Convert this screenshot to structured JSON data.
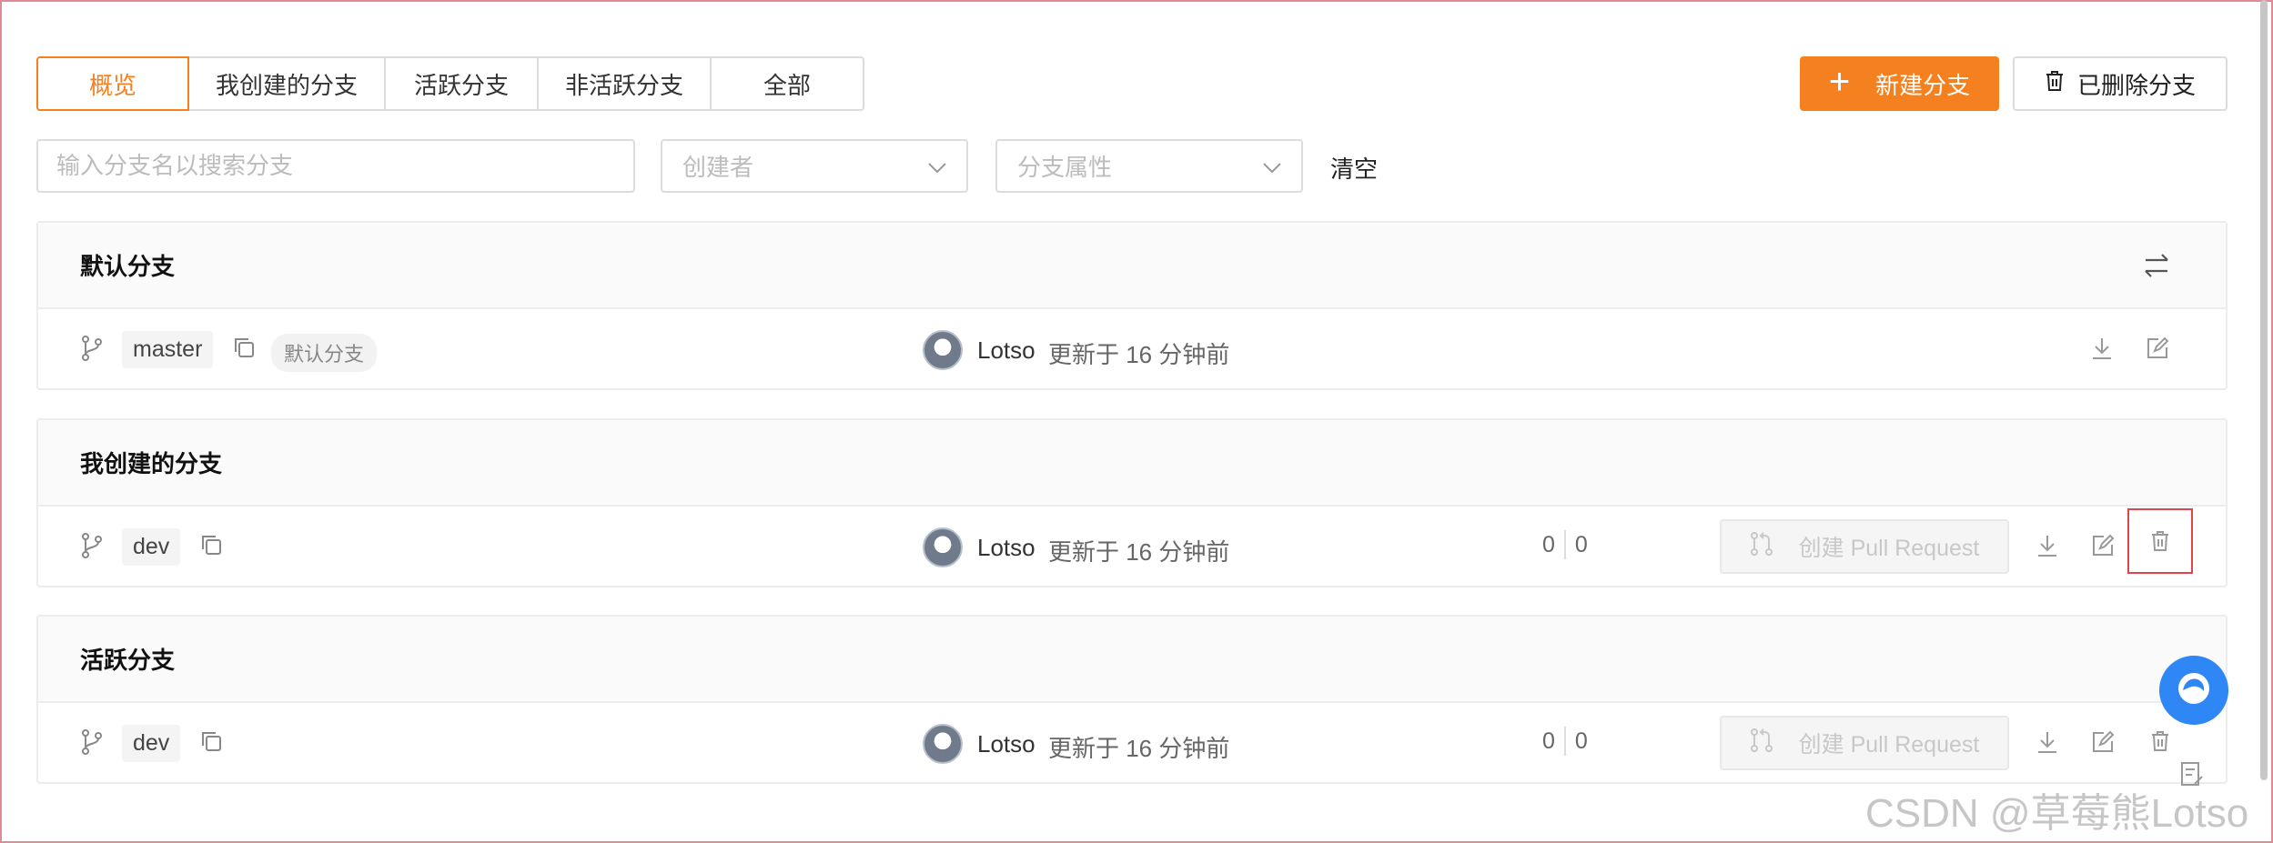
{
  "tabs": [
    {
      "label": "概览",
      "active": true
    },
    {
      "label": "我创建的分支",
      "active": false
    },
    {
      "label": "活跃分支",
      "active": false
    },
    {
      "label": "非活跃分支",
      "active": false
    },
    {
      "label": "全部",
      "active": false
    }
  ],
  "actions": {
    "new_branch": "新建分支",
    "deleted_branches": "已删除分支"
  },
  "filters": {
    "search_placeholder": "输入分支名以搜索分支",
    "creator_placeholder": "创建者",
    "attribute_placeholder": "分支属性",
    "clear": "清空"
  },
  "sections": {
    "default": {
      "title": "默认分支",
      "row": {
        "branch": "master",
        "tag": "默认分支",
        "author": "Lotso",
        "updated": "更新于 16 分钟前"
      }
    },
    "mine": {
      "title": "我创建的分支",
      "row": {
        "branch": "dev",
        "author": "Lotso",
        "updated": "更新于 16 分钟前",
        "behind": "0",
        "ahead": "0",
        "pr_label": "创建 Pull Request"
      }
    },
    "active": {
      "title": "活跃分支",
      "row": {
        "branch": "dev",
        "author": "Lotso",
        "updated": "更新于 16 分钟前",
        "behind": "0",
        "ahead": "0",
        "pr_label": "创建 Pull Request"
      }
    }
  },
  "watermark": "CSDN @草莓熊Lotso",
  "colors": {
    "accent": "#f5801f",
    "highlight_border": "#e0454f",
    "fab": "#2f86f5"
  }
}
